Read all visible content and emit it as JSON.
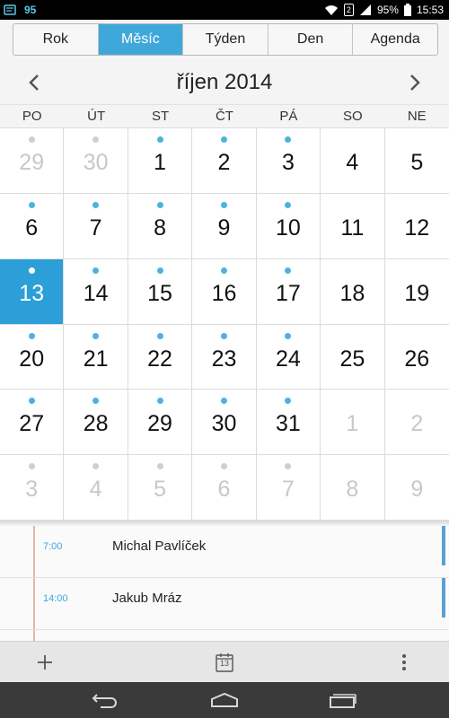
{
  "status": {
    "notification_count": "95",
    "battery": "95%",
    "time": "15:53",
    "sim": "2"
  },
  "tabs": [
    {
      "label": "Rok",
      "active": false
    },
    {
      "label": "Měsíc",
      "active": true
    },
    {
      "label": "Týden",
      "active": false
    },
    {
      "label": "Den",
      "active": false
    },
    {
      "label": "Agenda",
      "active": false
    }
  ],
  "month": {
    "title": "říjen 2014"
  },
  "weekdays": [
    "PO",
    "ÚT",
    "ST",
    "ČT",
    "PÁ",
    "SO",
    "NE"
  ],
  "days": [
    {
      "n": "29",
      "muted": true,
      "dot": true
    },
    {
      "n": "30",
      "muted": true,
      "dot": true
    },
    {
      "n": "1",
      "muted": false,
      "dot": true
    },
    {
      "n": "2",
      "muted": false,
      "dot": true
    },
    {
      "n": "3",
      "muted": false,
      "dot": true
    },
    {
      "n": "4",
      "muted": false,
      "dot": false
    },
    {
      "n": "5",
      "muted": false,
      "dot": false
    },
    {
      "n": "6",
      "muted": false,
      "dot": true
    },
    {
      "n": "7",
      "muted": false,
      "dot": true
    },
    {
      "n": "8",
      "muted": false,
      "dot": true
    },
    {
      "n": "9",
      "muted": false,
      "dot": true
    },
    {
      "n": "10",
      "muted": false,
      "dot": true
    },
    {
      "n": "11",
      "muted": false,
      "dot": false
    },
    {
      "n": "12",
      "muted": false,
      "dot": false
    },
    {
      "n": "13",
      "muted": false,
      "dot": true,
      "selected": true
    },
    {
      "n": "14",
      "muted": false,
      "dot": true
    },
    {
      "n": "15",
      "muted": false,
      "dot": true
    },
    {
      "n": "16",
      "muted": false,
      "dot": true
    },
    {
      "n": "17",
      "muted": false,
      "dot": true
    },
    {
      "n": "18",
      "muted": false,
      "dot": false
    },
    {
      "n": "19",
      "muted": false,
      "dot": false
    },
    {
      "n": "20",
      "muted": false,
      "dot": true
    },
    {
      "n": "21",
      "muted": false,
      "dot": true
    },
    {
      "n": "22",
      "muted": false,
      "dot": true
    },
    {
      "n": "23",
      "muted": false,
      "dot": true
    },
    {
      "n": "24",
      "muted": false,
      "dot": true
    },
    {
      "n": "25",
      "muted": false,
      "dot": false
    },
    {
      "n": "26",
      "muted": false,
      "dot": false
    },
    {
      "n": "27",
      "muted": false,
      "dot": true
    },
    {
      "n": "28",
      "muted": false,
      "dot": true
    },
    {
      "n": "29",
      "muted": false,
      "dot": true
    },
    {
      "n": "30",
      "muted": false,
      "dot": true
    },
    {
      "n": "31",
      "muted": false,
      "dot": true
    },
    {
      "n": "1",
      "muted": true,
      "dot": false
    },
    {
      "n": "2",
      "muted": true,
      "dot": false
    },
    {
      "n": "3",
      "muted": true,
      "dot": true
    },
    {
      "n": "4",
      "muted": true,
      "dot": true
    },
    {
      "n": "5",
      "muted": true,
      "dot": true
    },
    {
      "n": "6",
      "muted": true,
      "dot": true
    },
    {
      "n": "7",
      "muted": true,
      "dot": true
    },
    {
      "n": "8",
      "muted": true,
      "dot": false
    },
    {
      "n": "9",
      "muted": true,
      "dot": false
    }
  ],
  "events": [
    {
      "time": "7:00",
      "name": "Michal Pavlíček"
    },
    {
      "time": "14:00",
      "name": "Jakub Mráz"
    }
  ],
  "toolbar": {
    "today_number": "13",
    "icons": [
      "plus-icon",
      "calendar-today-icon",
      "overflow-menu-icon"
    ]
  },
  "navbar": {
    "icons": [
      "back-icon",
      "home-icon",
      "recent-apps-icon"
    ]
  },
  "colors": {
    "accent": "#3fa8da",
    "selected_day": "#2c9fd8",
    "event_dot": "#4cb3e0",
    "event_bar": "#5aa0cf",
    "timeline": "#e6b4a6"
  }
}
